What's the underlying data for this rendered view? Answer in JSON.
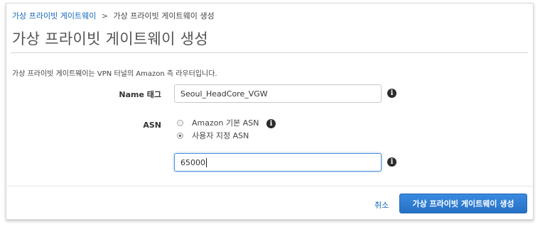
{
  "breadcrumb": {
    "parent": "가상 프라이빗 게이트웨이",
    "separator": ">",
    "current": "가상 프라이빗 게이트웨이 생성"
  },
  "page_title": "가상 프라이빗 게이트웨이 생성",
  "description": "가상 프라이빗 게이트웨이는 VPN 터널의 Amazon 측 라우터입니다.",
  "form": {
    "name_tag": {
      "label": "Name 태그",
      "value": "Seoul_HeadCore_VGW"
    },
    "asn": {
      "label": "ASN",
      "options": [
        {
          "label": "Amazon 기본 ASN",
          "checked": false
        },
        {
          "label": "사용자 지정 ASN",
          "checked": true
        }
      ],
      "custom_value": "65000"
    }
  },
  "footer": {
    "cancel_label": "취소",
    "submit_label": "가상 프라이빗 게이트웨이 생성"
  },
  "icons": {
    "info": "info-icon"
  },
  "colors": {
    "link": "#1166bb",
    "primary_button": "#2b7bd3",
    "focus_border": "#4d90d8"
  }
}
